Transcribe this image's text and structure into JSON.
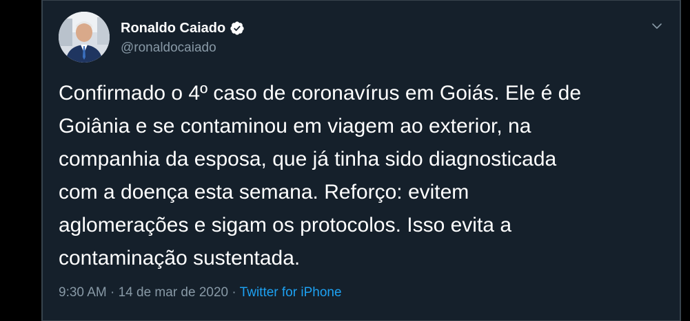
{
  "tweet": {
    "author": {
      "name": "Ronaldo Caiado",
      "handle": "@ronaldocaiado",
      "verified": true
    },
    "text": "Confirmado o 4º caso de coronavírus em Goiás. Ele é de\nGoiânia e se contaminou em viagem ao exterior, na\ncompanhia da esposa, que já tinha sido diagnosticada\ncom a doença esta semana. Reforço: evitem\naglomerações e sigam os protocolos. Isso evita a\ncontaminação sustentada.",
    "time": "9:30 AM",
    "separator": " · ",
    "date": "14 de mar de 2020",
    "separator2": " · ",
    "source": "Twitter for iPhone"
  },
  "colors": {
    "background": "#15202b",
    "text": "#ffffff",
    "muted": "#8899a6",
    "accent": "#1da1f2",
    "border": "#38444d"
  },
  "icons": {
    "verified": "verified-badge-icon",
    "menu": "chevron-down-icon"
  }
}
